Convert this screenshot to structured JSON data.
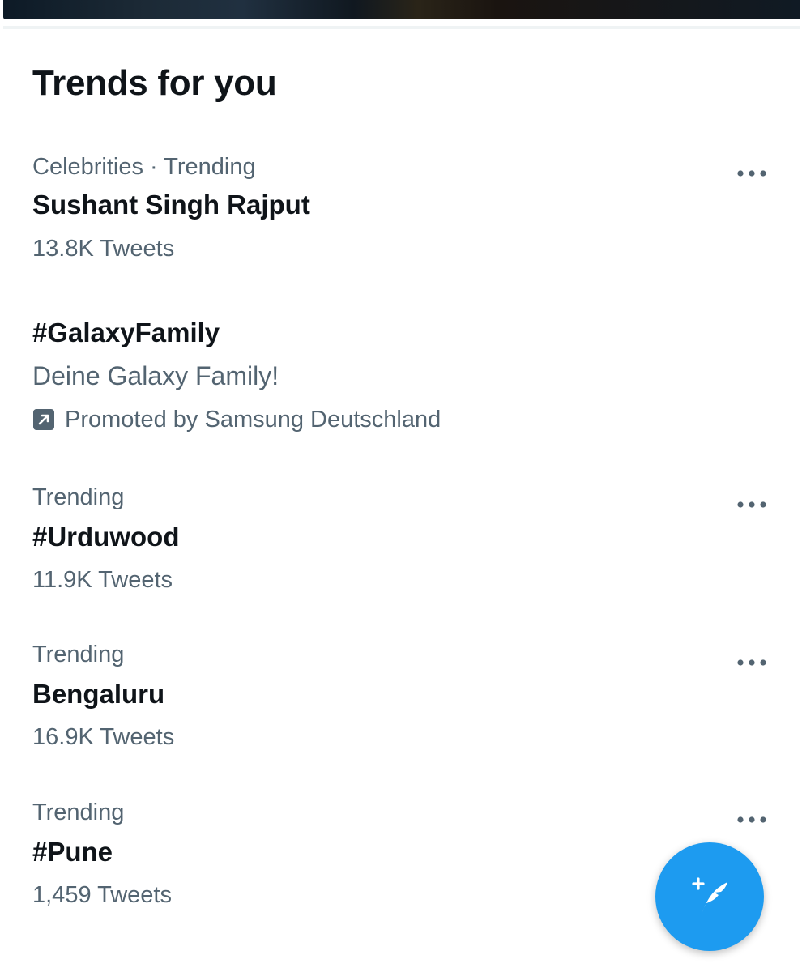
{
  "section": {
    "title": "Trends for you"
  },
  "trends": [
    {
      "meta": "Celebrities · Trending",
      "name": "Sushant Singh Rajput",
      "count": "13.8K Tweets"
    },
    {
      "meta": "Trending",
      "name": "#Urduwood",
      "count": "11.9K Tweets"
    },
    {
      "meta": "Trending",
      "name": "Bengaluru",
      "count": "16.9K Tweets"
    },
    {
      "meta": "Trending",
      "name": "#Pune",
      "count": "1,459 Tweets"
    }
  ],
  "promoted": {
    "name": "#GalaxyFamily",
    "description": "Deine Galaxy Family!",
    "promoted_by": "Promoted by Samsung Deutschland"
  },
  "icons": {
    "more": "more-horizontal-icon",
    "promoted": "promoted-arrow-icon",
    "compose": "compose-tweet-icon"
  },
  "colors": {
    "accent": "#1d9bf0",
    "primary_text": "#0f1419",
    "secondary_text": "#536471"
  }
}
